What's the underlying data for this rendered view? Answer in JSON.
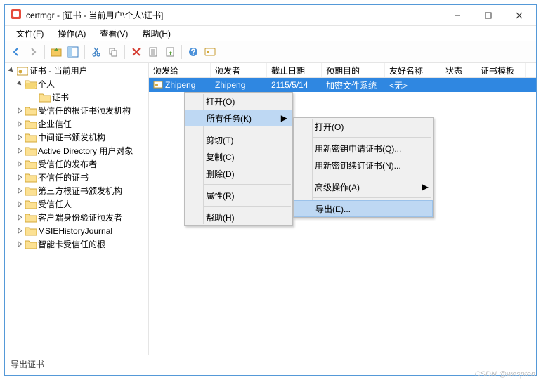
{
  "window": {
    "title": "certmgr - [证书 - 当前用户\\个人\\证书]"
  },
  "menubar": {
    "file": "文件(F)",
    "action": "操作(A)",
    "view": "查看(V)",
    "help": "帮助(H)"
  },
  "tree": {
    "root": "证书 - 当前用户",
    "personal": "个人",
    "certificates": "证书",
    "trustedRoot": "受信任的根证书颁发机构",
    "enterpriseTrust": "企业信任",
    "intermediateCA": "中间证书颁发机构",
    "adUserObj": "Active Directory 用户对象",
    "trustedPublishers": "受信任的发布者",
    "untrustedCert": "不信任的证书",
    "thirdPartyRoot": "第三方根证书颁发机构",
    "trustedPeople": "受信任人",
    "clientAuth": "客户端身份验证颁发者",
    "msieHistory": "MSIEHistoryJournal",
    "smartCardRoot": "智能卡受信任的根"
  },
  "columns": {
    "issuedTo": "颁发给",
    "issuedBy": "颁发者",
    "expiry": "截止日期",
    "purpose": "预期目的",
    "friendlyName": "友好名称",
    "status": "状态",
    "template": "证书模板"
  },
  "row": {
    "issuedTo": "Zhipeng",
    "issuedBy": "Zhipeng",
    "expiry": "2115/5/14",
    "purpose": "加密文件系统",
    "friendlyName": "<无>",
    "status": "",
    "template": ""
  },
  "ctx1": {
    "open": "打开(O)",
    "allTasks": "所有任务(K)",
    "cut": "剪切(T)",
    "copy": "复制(C)",
    "delete": "删除(D)",
    "properties": "属性(R)",
    "help": "帮助(H)"
  },
  "ctx2": {
    "open": "打开(O)",
    "reqNewKey": "用新密钥申请证书(Q)...",
    "renewNewKey": "用新密钥续订证书(N)...",
    "advanced": "高级操作(A)",
    "export": "导出(E)..."
  },
  "statusbar": "导出证书",
  "watermark": "CSDN @wespten"
}
